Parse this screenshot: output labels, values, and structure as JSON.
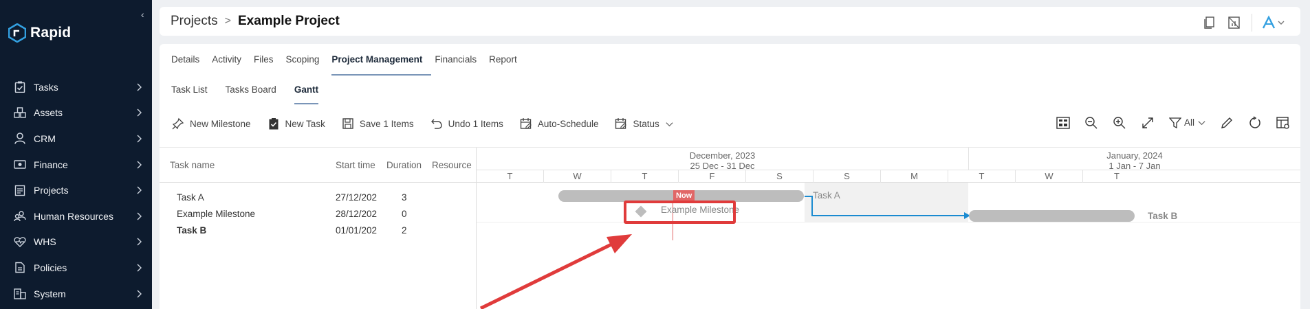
{
  "app": {
    "name": "Rapid"
  },
  "sidebar": {
    "items": [
      {
        "label": "Tasks",
        "icon": "clipboard-check-icon"
      },
      {
        "label": "Assets",
        "icon": "boxes-icon"
      },
      {
        "label": "CRM",
        "icon": "user-icon"
      },
      {
        "label": "Finance",
        "icon": "money-icon"
      },
      {
        "label": "Projects",
        "icon": "document-icon"
      },
      {
        "label": "Human Resources",
        "icon": "people-icon"
      },
      {
        "label": "WHS",
        "icon": "heart-pulse-icon"
      },
      {
        "label": "Policies",
        "icon": "policy-document-icon"
      },
      {
        "label": "System",
        "icon": "system-icon"
      }
    ]
  },
  "breadcrumb": {
    "parent": "Projects",
    "separator": ">",
    "current": "Example Project"
  },
  "tabs": [
    "Details",
    "Activity",
    "Files",
    "Scoping",
    "Project Management",
    "Financials",
    "Report"
  ],
  "active_tab": "Project Management",
  "subtabs": [
    "Task List",
    "Tasks Board",
    "Gantt"
  ],
  "active_subtab": "Gantt",
  "toolbar": {
    "new_milestone": "New Milestone",
    "new_task": "New Task",
    "save": "Save 1 Items",
    "undo": "Undo 1 Items",
    "auto_schedule": "Auto-Schedule",
    "status": "Status",
    "filter_all": "All"
  },
  "gantt": {
    "columns": {
      "task_name": "Task name",
      "start_time": "Start time",
      "duration": "Duration",
      "resource": "Resource"
    },
    "rows": [
      {
        "name": "Task A",
        "start": "27/12/202",
        "duration": "3",
        "bold": false
      },
      {
        "name": "Example Milestone",
        "start": "28/12/202",
        "duration": "0",
        "bold": false
      },
      {
        "name": "Task B",
        "start": "01/01/202",
        "duration": "2",
        "bold": true
      }
    ],
    "months": [
      {
        "title": "December, 2023",
        "range": "25 Dec - 31 Dec"
      },
      {
        "title": "January, 2024",
        "range": "1 Jan - 7 Jan"
      }
    ],
    "days": [
      "T",
      "W",
      "T",
      "F",
      "S",
      "S",
      "M",
      "T",
      "W",
      "T"
    ],
    "now_label": "Now",
    "bar_labels": {
      "task_a": "Task A",
      "milestone": "Example Milestone",
      "task_b": "Task B"
    }
  },
  "colors": {
    "sidebar_bg": "#0d1b2e",
    "accent": "#1b8bd1",
    "now": "#e16767",
    "highlight": "#e03b3b",
    "bar": "#bdbdbd"
  }
}
